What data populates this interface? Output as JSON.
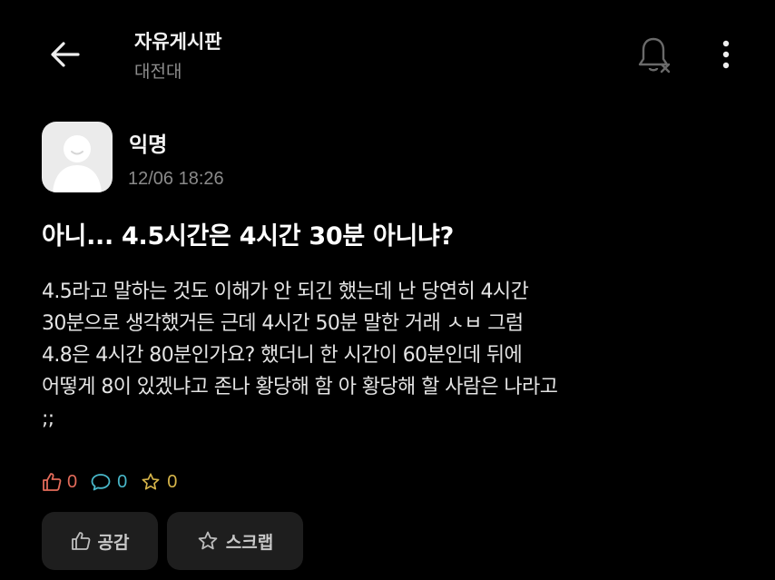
{
  "header": {
    "board_title": "자유게시판",
    "school": "대전대",
    "icons": {
      "back": "back-arrow-icon",
      "notify": "bell-off-icon",
      "more": "more-vertical-icon"
    }
  },
  "post": {
    "author": "익명",
    "timestamp": "12/06 18:26",
    "title": "아니... 4.5시간은 4시간 30분 아니냐?",
    "body_lines": [
      "4.5라고 말하는 것도 이해가 안 되긴 했는데 난 당연히 4시간",
      "30분으로 생각했거든 근데 4시간 50분 말한 거래 ㅅㅂ 그럼",
      "4.8은 4시간 80분인가요? 했더니 한 시간이 60분인데 뒤에",
      "어떻게 8이 있겠냐고 존나 황당해 함 아 황당해 할 사람은 나라고",
      ";;"
    ]
  },
  "stats": {
    "likes": "0",
    "comments": "0",
    "scraps": "0"
  },
  "actions": {
    "empathy_label": "공감",
    "scrap_label": "스크랩"
  },
  "colors": {
    "like": "#e36b5a",
    "comment": "#48b7c9",
    "scrap": "#d7b54a",
    "background": "#000000",
    "button_bg": "#1e1e1e"
  }
}
